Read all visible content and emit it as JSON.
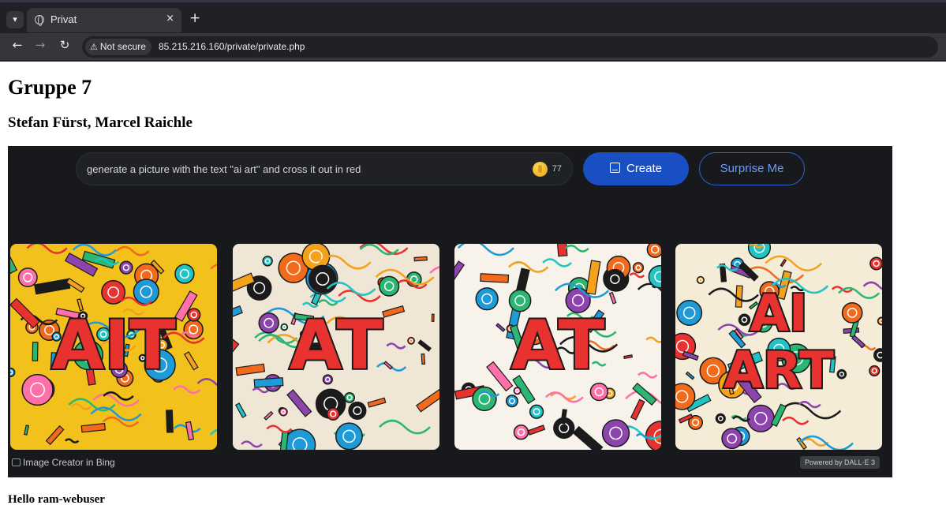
{
  "browser": {
    "tab_title": "Privat",
    "tab_close": "×",
    "new_tab": "+",
    "security_label": "Not secure",
    "url": "85.215.216.160/private/private.php"
  },
  "page": {
    "heading": "Gruppe 7",
    "authors": "Stefan Fürst, Marcel Raichle",
    "greeting": "Hello ram-webuser"
  },
  "bing": {
    "prompt": "generate a picture with the text \"ai art\" and cross it out in red",
    "coins": "77",
    "create_label": "Create",
    "surprise_label": "Surprise Me",
    "footer_label": "Image Creator in Bing",
    "powered_by": "Powered by DALL·E 3",
    "images": [
      {
        "text_lines": [
          "AIT"
        ],
        "bg": "#f3c11c"
      },
      {
        "text_lines": [
          "AT"
        ],
        "bg": "#f0e6d6"
      },
      {
        "text_lines": [
          "AT"
        ],
        "bg": "#f7f2ea"
      },
      {
        "text_lines": [
          "AI",
          "ART"
        ],
        "bg": "#f5ecd8"
      }
    ]
  },
  "colors": {
    "accent_blue": "#1a4fc4",
    "art_red": "#e8322f"
  }
}
